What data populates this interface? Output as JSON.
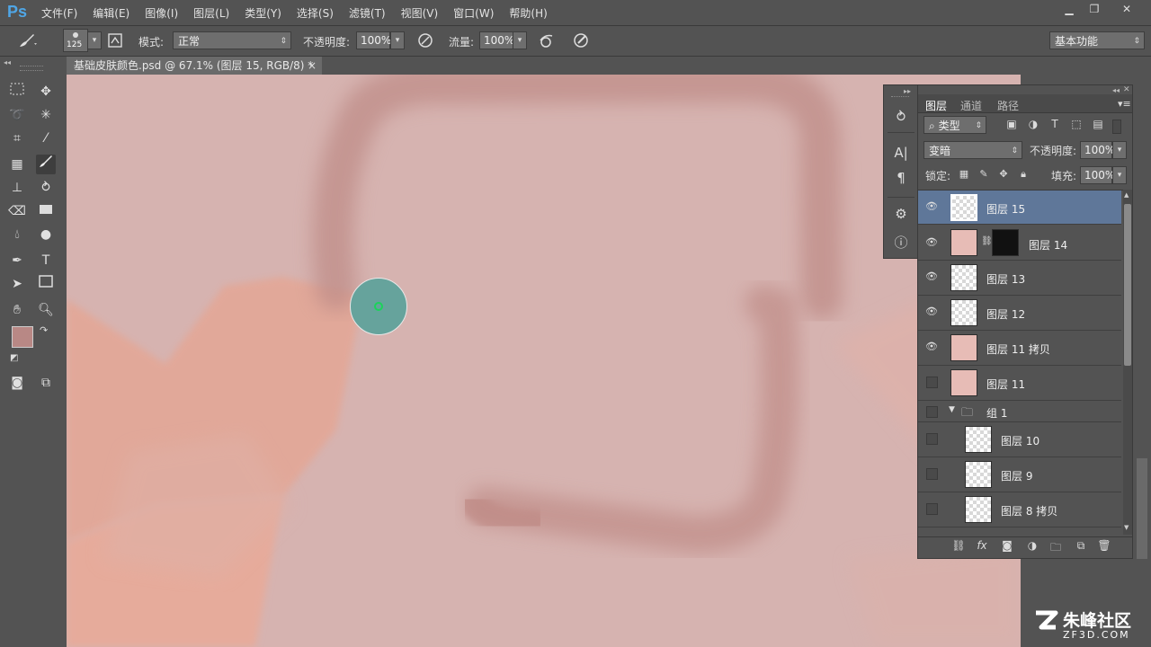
{
  "app": {
    "logo": "Ps"
  },
  "menu": [
    "文件(F)",
    "编辑(E)",
    "图像(I)",
    "图层(L)",
    "类型(Y)",
    "选择(S)",
    "滤镜(T)",
    "视图(V)",
    "窗口(W)",
    "帮助(H)"
  ],
  "window_controls": {
    "minimize": "▁",
    "restore": "❐",
    "close": "✕"
  },
  "options": {
    "brush_size": "125",
    "mode_label": "模式:",
    "mode_value": "正常",
    "opacity_label": "不透明度:",
    "opacity_value": "100%",
    "flow_label": "流量:",
    "flow_value": "100%",
    "workspace": "基本功能"
  },
  "document": {
    "tab_title": "基础皮肤颜色.psd @ 67.1% (图层 15, RGB/8) *",
    "close": "×"
  },
  "colors": {
    "foreground": "#b88885",
    "background": "#111111",
    "canvas_skin": "#d6b3b0",
    "stroke": "#bf8d88",
    "brush": "#66a39c",
    "selected_layer": "#5f7799"
  },
  "layers_panel": {
    "tabs": [
      "图层",
      "通道",
      "路径"
    ],
    "filter_kind": "类型",
    "blend_mode": "变暗",
    "opacity_label": "不透明度:",
    "opacity_value": "100%",
    "lock_label": "锁定:",
    "fill_label": "填充:",
    "fill_value": "100%",
    "layers": [
      {
        "name": "图层 15",
        "visible": true,
        "selected": true,
        "thumb": "face-transparent"
      },
      {
        "name": "图层 14",
        "visible": true,
        "selected": false,
        "thumb": "face",
        "has_mask": true
      },
      {
        "name": "图层 13",
        "visible": true,
        "selected": false,
        "thumb": "transparent"
      },
      {
        "name": "图层 12",
        "visible": true,
        "selected": false,
        "thumb": "transparent"
      },
      {
        "name": "图层 11 拷贝",
        "visible": true,
        "selected": false,
        "thumb": "face"
      },
      {
        "name": "图层 11",
        "visible": false,
        "selected": false,
        "thumb": "face"
      },
      {
        "name": "组 1",
        "visible": false,
        "selected": false,
        "group": true
      },
      {
        "name": "图层 10",
        "visible": false,
        "selected": false,
        "thumb": "transparent",
        "indent": true
      },
      {
        "name": "图层 9",
        "visible": false,
        "selected": false,
        "thumb": "transparent",
        "indent": true
      },
      {
        "name": "图层 8 拷贝",
        "visible": false,
        "selected": false,
        "thumb": "face-transparent",
        "indent": true
      }
    ]
  },
  "watermark": {
    "brand": "朱峰社区",
    "url": "ZF3D.COM"
  }
}
